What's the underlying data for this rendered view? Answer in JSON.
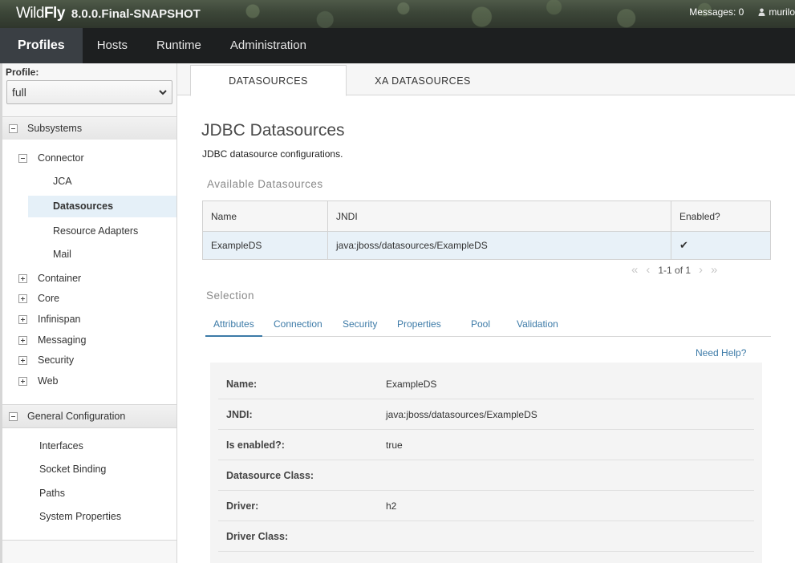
{
  "header": {
    "brand_wild": "Wild",
    "brand_fly": "Fly",
    "version": "8.0.0.Final-SNAPSHOT",
    "messages_label": "Messages: 0",
    "user": "murilo"
  },
  "main_nav": {
    "items": [
      "Profiles",
      "Hosts",
      "Runtime",
      "Administration"
    ],
    "active": "Profiles"
  },
  "sidebar": {
    "profile_label": "Profile:",
    "profile_value": "full",
    "subsystems_label": "Subsystems",
    "connector_label": "Connector",
    "connector_children": [
      "JCA",
      "Datasources",
      "Resource Adapters",
      "Mail"
    ],
    "selected": "Datasources",
    "groups": [
      "Container",
      "Core",
      "Infinispan",
      "Messaging",
      "Security",
      "Web"
    ],
    "general_label": "General Configuration",
    "general_items": [
      "Interfaces",
      "Socket Binding",
      "Paths",
      "System Properties"
    ]
  },
  "tabs": [
    "DATASOURCES",
    "XA DATASOURCES"
  ],
  "page": {
    "title": "JDBC Datasources",
    "description": "JDBC datasource configurations."
  },
  "available": {
    "title": "Available Datasources",
    "columns": [
      "Name",
      "JNDI",
      "Enabled?"
    ],
    "rows": [
      {
        "name": "ExampleDS",
        "jndi": "java:jboss/datasources/ExampleDS",
        "enabled": "✔"
      }
    ],
    "pager": "1-1 of 1"
  },
  "selection": {
    "title": "Selection",
    "tabs": [
      "Attributes",
      "Connection",
      "Security",
      "Properties",
      "Pool",
      "Validation"
    ],
    "active_tab": "Attributes",
    "need_help": "Need Help?",
    "attributes": [
      {
        "label": "Name:",
        "value": "ExampleDS"
      },
      {
        "label": "JNDI:",
        "value": "java:jboss/datasources/ExampleDS"
      },
      {
        "label": "Is enabled?:",
        "value": "true"
      },
      {
        "label": "Datasource Class:",
        "value": ""
      },
      {
        "label": "Driver:",
        "value": "h2"
      },
      {
        "label": "Driver Class:",
        "value": ""
      }
    ]
  },
  "colors": {
    "nav_bg": "#1d1f20",
    "nav_active": "#3a3f44",
    "link": "#3c7aa7",
    "selected_row": "#e8f1f8"
  }
}
